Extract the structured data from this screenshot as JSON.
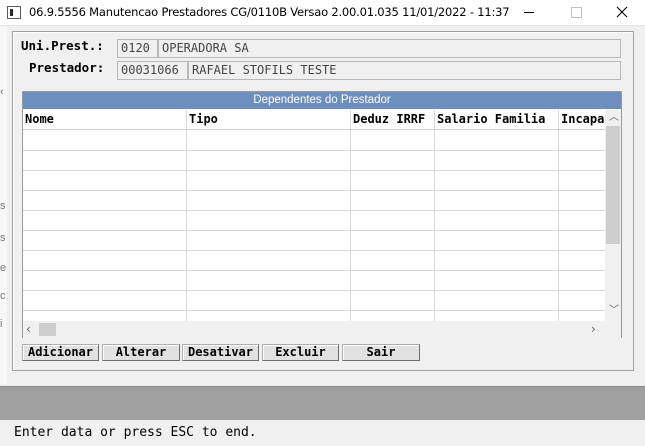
{
  "window": {
    "title": "06.9.5556 Manutencao  Prestadores CG/0110B Versao 2.00.01.035 11/01/2022 - 11:37"
  },
  "form": {
    "uni_prest_label": "Uni.Prest.:",
    "uni_prest_code": "0120",
    "uni_prest_name": "OPERADORA SA",
    "prestador_label": "Prestador:",
    "prestador_code": "00031066",
    "prestador_name": "RAFAEL STOFILS TESTE"
  },
  "grid": {
    "caption": "Dependentes do Prestador",
    "columns": [
      "Nome",
      "Tipo",
      "Deduz IRRF",
      "Salario Familia",
      "Incapaz"
    ],
    "rows": []
  },
  "buttons": {
    "add": "Adicionar",
    "edit": "Alterar",
    "deactivate": "Desativar",
    "delete": "Excluir",
    "exit": "Sair"
  },
  "status": {
    "message": "Enter data or press ESC to end."
  },
  "icons": {
    "app": "app-window-icon",
    "minimize": "minimize-icon",
    "maximize": "maximize-icon",
    "close": "close-icon",
    "scroll_up": "chevron-up-icon",
    "scroll_down": "chevron-down-icon",
    "scroll_left": "chevron-left-icon",
    "scroll_right": "chevron-right-icon"
  },
  "colors": {
    "grid_caption_bg": "#6d8fc0",
    "window_bg": "#f0f0f0",
    "gray_band": "#a0a0a0"
  }
}
